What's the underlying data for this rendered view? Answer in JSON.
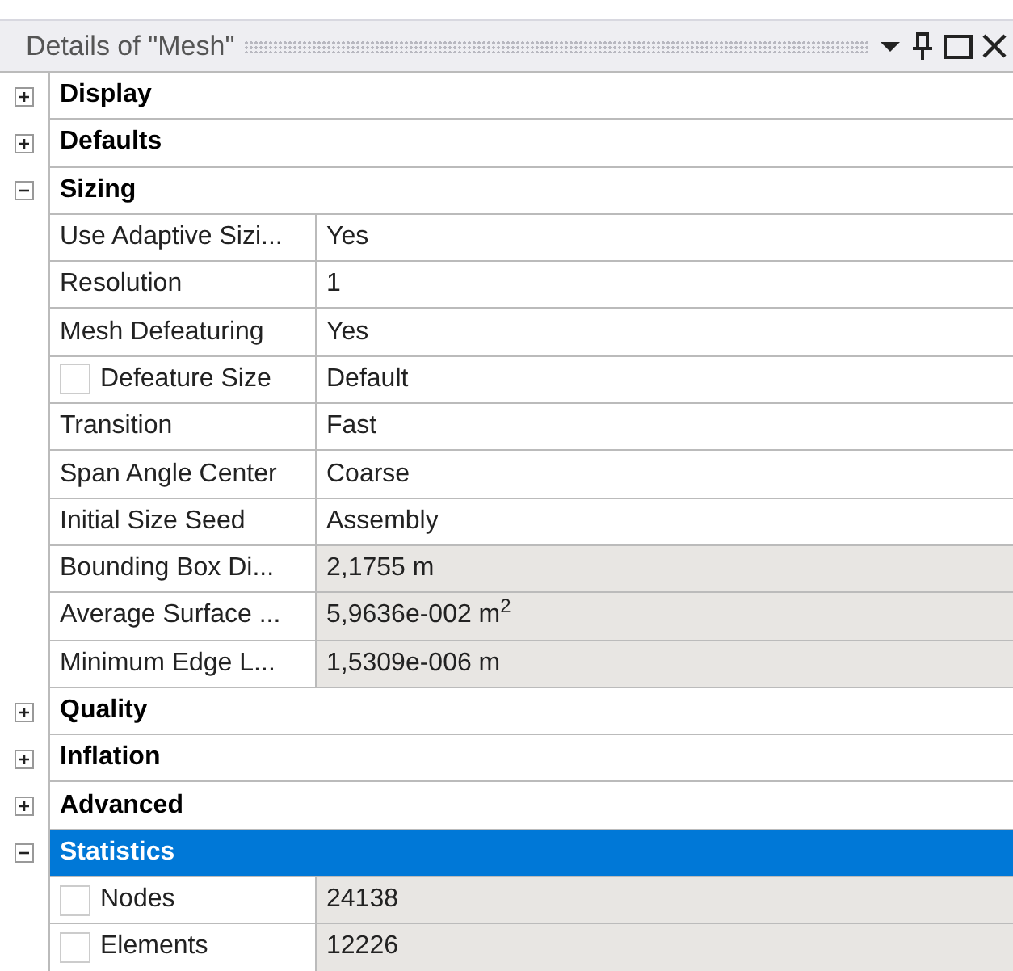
{
  "panel": {
    "title": "Details of \"Mesh\""
  },
  "sections": [
    {
      "label": "Display",
      "expanded": false,
      "selected": false
    },
    {
      "label": "Defaults",
      "expanded": false,
      "selected": false
    },
    {
      "label": "Sizing",
      "expanded": true,
      "selected": false,
      "rows": [
        {
          "label": "Use Adaptive Sizi...",
          "value": "Yes",
          "read_only": false
        },
        {
          "label": "Resolution",
          "value": "1",
          "read_only": false
        },
        {
          "label": "Mesh Defeaturing",
          "value": "Yes",
          "read_only": false
        },
        {
          "label": "Defeature Size",
          "value": "Default",
          "read_only": false,
          "checked": false
        },
        {
          "label": "Transition",
          "value": "Fast",
          "read_only": false
        },
        {
          "label": "Span Angle Center",
          "value": "Coarse",
          "read_only": false
        },
        {
          "label": "Initial Size Seed",
          "value": "Assembly",
          "read_only": false
        },
        {
          "label": "Bounding Box Di...",
          "value": "2,1755 m",
          "read_only": true
        },
        {
          "label": "Average Surface ...",
          "value": "5,9636e-002 m$^{2}$",
          "read_only": true
        },
        {
          "label": "Minimum Edge L...",
          "value": "1,5309e-006 m",
          "read_only": true
        }
      ]
    },
    {
      "label": "Quality",
      "expanded": false,
      "selected": false
    },
    {
      "label": "Inflation",
      "expanded": false,
      "selected": false
    },
    {
      "label": "Advanced",
      "expanded": false,
      "selected": false
    },
    {
      "label": "Statistics",
      "expanded": true,
      "selected": true,
      "rows": [
        {
          "label": "Nodes",
          "value": "24138",
          "read_only": true,
          "checked": false
        },
        {
          "label": "Elements",
          "value": "12226",
          "read_only": true,
          "checked": false
        }
      ]
    }
  ]
}
